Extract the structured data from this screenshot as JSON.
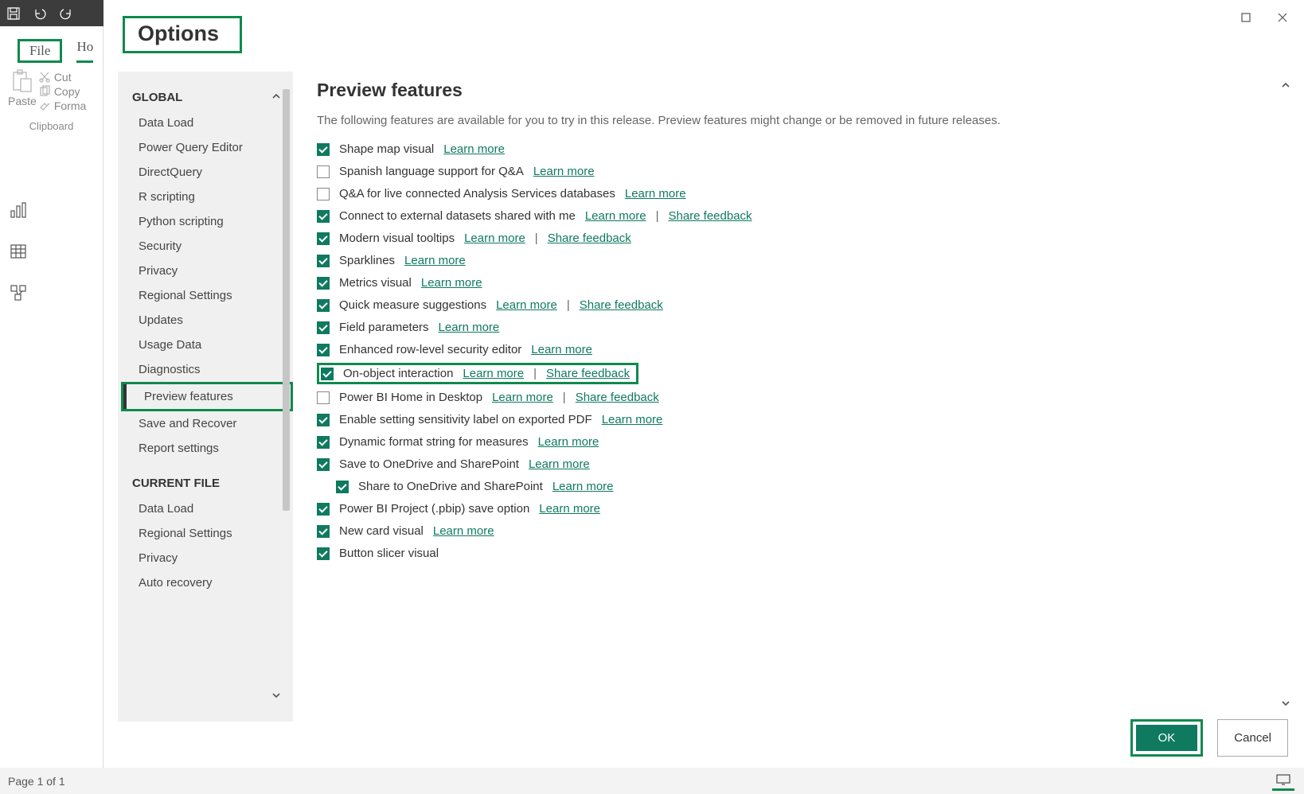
{
  "qat": {
    "save_icon": "save-icon",
    "undo_icon": "undo-icon",
    "redo_icon": "redo-icon"
  },
  "ribbon": {
    "file_tab": "File",
    "home_tab": "Ho",
    "paste_label": "Paste",
    "cut_label": "Cut",
    "copy_label": "Copy",
    "format_label": "Forma",
    "clipboard_group": "Clipboard"
  },
  "statusbar": {
    "page_label": "Page 1 of 1"
  },
  "dialog": {
    "title": "Options",
    "ok_label": "OK",
    "cancel_label": "Cancel"
  },
  "sidebar": {
    "global_header": "GLOBAL",
    "current_header": "CURRENT FILE",
    "global_items": [
      "Data Load",
      "Power Query Editor",
      "DirectQuery",
      "R scripting",
      "Python scripting",
      "Security",
      "Privacy",
      "Regional Settings",
      "Updates",
      "Usage Data",
      "Diagnostics",
      "Preview features",
      "Save and Recover",
      "Report settings"
    ],
    "current_items": [
      "Data Load",
      "Regional Settings",
      "Privacy",
      "Auto recovery"
    ],
    "active_index": 11
  },
  "content": {
    "title": "Preview features",
    "description": "The following features are available for you to try in this release. Preview features might change or be removed in future releases.",
    "learn_more": "Learn more",
    "share_feedback": "Share feedback",
    "features": [
      {
        "label": "Shape map visual",
        "checked": true,
        "learn": true
      },
      {
        "label": "Spanish language support for Q&A",
        "checked": false,
        "learn": true
      },
      {
        "label": "Q&A for live connected Analysis Services databases",
        "checked": false,
        "learn": true
      },
      {
        "label": "Connect to external datasets shared with me",
        "checked": true,
        "learn": true,
        "feedback": true
      },
      {
        "label": "Modern visual tooltips",
        "checked": true,
        "learn": true,
        "feedback": true
      },
      {
        "label": "Sparklines",
        "checked": true,
        "learn": true
      },
      {
        "label": "Metrics visual",
        "checked": true,
        "learn": true
      },
      {
        "label": "Quick measure suggestions",
        "checked": true,
        "learn": true,
        "feedback": true
      },
      {
        "label": "Field parameters",
        "checked": true,
        "learn": true
      },
      {
        "label": "Enhanced row-level security editor",
        "checked": true,
        "learn": true
      },
      {
        "label": "On-object interaction",
        "checked": true,
        "learn": true,
        "feedback": true,
        "boxed": true
      },
      {
        "label": "Power BI Home in Desktop",
        "checked": false,
        "learn": true,
        "feedback": true
      },
      {
        "label": "Enable setting sensitivity label on exported PDF",
        "checked": true,
        "learn": true
      },
      {
        "label": "Dynamic format string for measures",
        "checked": true,
        "learn": true
      },
      {
        "label": "Save to OneDrive and SharePoint",
        "checked": true,
        "learn": true
      },
      {
        "label": "Share to OneDrive and SharePoint",
        "checked": true,
        "learn": true,
        "sub": true
      },
      {
        "label": "Power BI Project (.pbip) save option",
        "checked": true,
        "learn": true
      },
      {
        "label": "New card visual",
        "checked": true,
        "learn": true
      },
      {
        "label": "Button slicer visual",
        "checked": true
      }
    ]
  }
}
